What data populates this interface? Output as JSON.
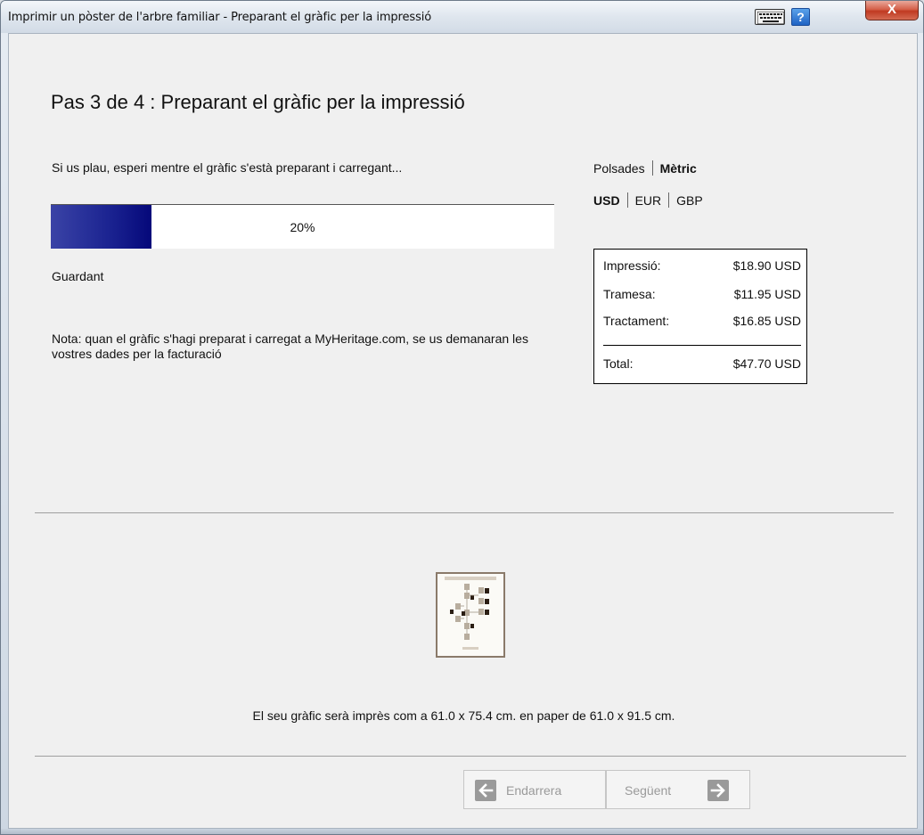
{
  "window": {
    "title": "Imprimir un pòster de l'arbre familiar - Preparant el gràfic per la impressió",
    "close_label": "X",
    "help_label": "?"
  },
  "step": {
    "title": "Pas 3 de 4 : Preparant el gràfic per la impressió",
    "wait_text": "Si us plau, esperi mentre el gràfic s'està preparant i carregant...",
    "progress_percent": 20,
    "progress_label": "20%",
    "status_text": "Guardant",
    "note_text": "Nota: quan el gràfic s'hagi preparat i carregat a MyHeritage.com, se us demanaran les vostres dades per la facturació"
  },
  "units": {
    "options": [
      "Polsades",
      "Mètric"
    ],
    "selected": "Mètric"
  },
  "currency": {
    "options": [
      "USD",
      "EUR",
      "GBP"
    ],
    "selected": "USD"
  },
  "prices": {
    "rows": [
      {
        "label": "Impressió:",
        "value": "$18.90 USD"
      },
      {
        "label": "Tramesa:",
        "value": "$11.95 USD"
      },
      {
        "label": "Tractament:",
        "value": "$16.85 USD"
      }
    ],
    "total": {
      "label": "Total:",
      "value": "$47.70 USD"
    }
  },
  "print_size_text": "El seu gràfic serà imprès com a 61.0 x 75.4 cm. en paper de 61.0 x 91.5 cm.",
  "nav": {
    "back_label": "Endarrera",
    "next_label": "Següent"
  }
}
